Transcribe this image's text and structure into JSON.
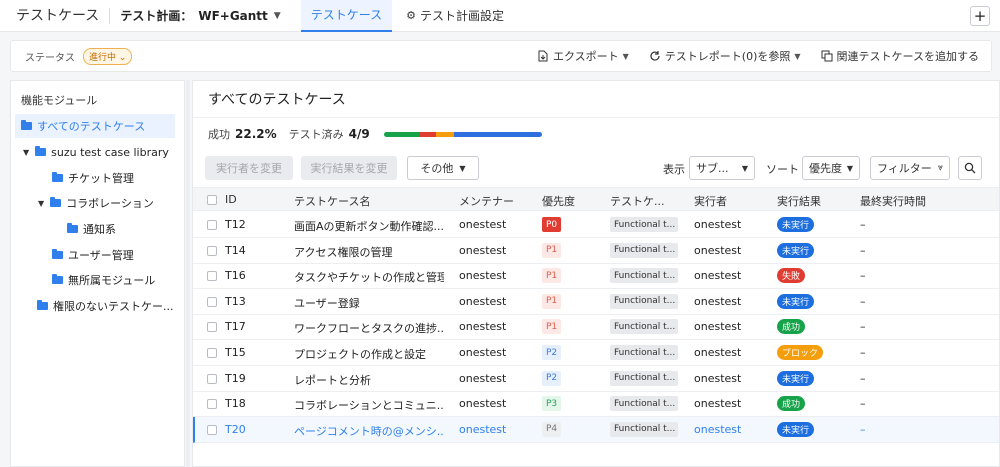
{
  "topbar": {
    "app_title": "テストケース",
    "plan_label": "テスト計画：",
    "plan_name": "WF+Gantt",
    "tabs": [
      {
        "label": "テストケース",
        "active": true
      },
      {
        "label": "テスト計画設定",
        "active": false
      }
    ],
    "plus_label": "+"
  },
  "statusbar": {
    "status_label": "ステータス",
    "status_value": "進行中",
    "actions": [
      "エクスポート",
      "テストレポート(0)を参照",
      "関連テストケースを追加する"
    ]
  },
  "sidebar": {
    "title": "機能モジュール",
    "items": [
      {
        "label": "すべてのテストケース",
        "selected": true
      },
      {
        "label": "suzu test case library",
        "expanded": true
      },
      {
        "label": "チケット管理"
      },
      {
        "label": "コラボレーション",
        "expanded": true
      },
      {
        "label": "通知系"
      },
      {
        "label": "ユーザー管理"
      },
      {
        "label": "無所属モジュール"
      },
      {
        "label": "権限のないテストケー..."
      }
    ]
  },
  "main": {
    "title": "すべてのテストケース",
    "stats": {
      "success_label": "成功",
      "success_value": "22.2%",
      "tested_label": "テスト済み",
      "tested_value": "4/9"
    },
    "progress_segments": [
      {
        "status": "成功",
        "count": 2,
        "color": "#17a34a"
      },
      {
        "status": "失敗",
        "count": 1,
        "color": "#e03c31"
      },
      {
        "status": "ブロック",
        "count": 1,
        "color": "#f59e0b"
      },
      {
        "status": "未実行",
        "count": 5,
        "color": "#2f6fe0"
      }
    ],
    "toolbar": {
      "change_executor": "実行者を変更",
      "change_result": "実行結果を変更",
      "more": "その他",
      "display_label": "表示",
      "display_value": "サブ...",
      "sort_label": "ソート",
      "sort_value": "優先度",
      "filter_label": "フィルター"
    },
    "columns": [
      "ID",
      "テストケース名",
      "メンテナー",
      "優先度",
      "テストケ...",
      "実行者",
      "実行結果",
      "最終実行時間"
    ],
    "rows": [
      {
        "id": "T12",
        "name": "画面Aの更新ボタン動作確認...",
        "maintainer": "onestest",
        "priority": "P0",
        "type": "Functional t...",
        "executor": "onestest",
        "result": "未実行",
        "last_run": "–"
      },
      {
        "id": "T14",
        "name": "アクセス権限の管理",
        "maintainer": "onestest",
        "priority": "P1",
        "type": "Functional t...",
        "executor": "onestest",
        "result": "未実行",
        "last_run": "–"
      },
      {
        "id": "T16",
        "name": "タスクやチケットの作成と管理",
        "maintainer": "onestest",
        "priority": "P1",
        "type": "Functional t...",
        "executor": "onestest",
        "result": "失敗",
        "last_run": "–"
      },
      {
        "id": "T13",
        "name": "ユーザー登録",
        "maintainer": "onestest",
        "priority": "P1",
        "type": "Functional t...",
        "executor": "onestest",
        "result": "未実行",
        "last_run": "–"
      },
      {
        "id": "T17",
        "name": "ワークフローとタスクの進捗...",
        "maintainer": "onestest",
        "priority": "P1",
        "type": "Functional t...",
        "executor": "onestest",
        "result": "成功",
        "last_run": "–"
      },
      {
        "id": "T15",
        "name": "プロジェクトの作成と設定",
        "maintainer": "onestest",
        "priority": "P2",
        "type": "Functional t...",
        "executor": "onestest",
        "result": "ブロック",
        "last_run": "–"
      },
      {
        "id": "T19",
        "name": "レポートと分析",
        "maintainer": "onestest",
        "priority": "P2",
        "type": "Functional t...",
        "executor": "onestest",
        "result": "未実行",
        "last_run": "–"
      },
      {
        "id": "T18",
        "name": "コラボレーションとコミュニ...",
        "maintainer": "onestest",
        "priority": "P3",
        "type": "Functional t...",
        "executor": "onestest",
        "result": "成功",
        "last_run": "–"
      },
      {
        "id": "T20",
        "name": "ページコメント時の@メンシ...",
        "maintainer": "onestest",
        "priority": "P4",
        "type": "Functional t...",
        "executor": "onestest",
        "result": "未実行",
        "last_run": "–"
      }
    ]
  },
  "colors": {
    "accent": "#2f80ed",
    "priority": {
      "P0": {
        "bg": "#e03c31",
        "fg": "#ffffff"
      },
      "P1": {
        "bg": "#fde8e6",
        "fg": "#e0604f"
      },
      "P2": {
        "bg": "#e6effc",
        "fg": "#3f7bd9"
      },
      "P3": {
        "bg": "#e4f6ea",
        "fg": "#2ca05a"
      },
      "P4": {
        "bg": "#eeeff1",
        "fg": "#777777"
      }
    },
    "result": {
      "未実行": "#1d6fe0",
      "失敗": "#e03c31",
      "成功": "#17a34a",
      "ブロック": "#f59e0b"
    }
  }
}
